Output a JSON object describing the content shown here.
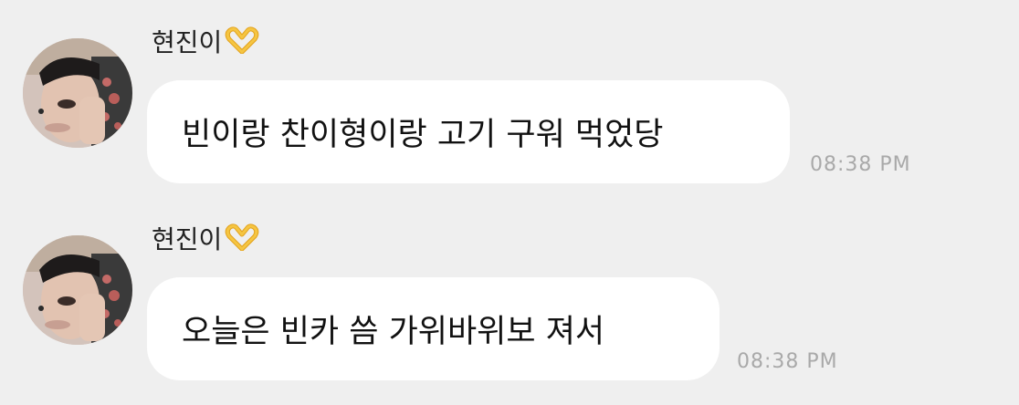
{
  "messages": [
    {
      "sender": "현진이",
      "sender_emoji": "heart-hands-icon",
      "text": "빈이랑 찬이형이랑 고기 구워 먹었당",
      "time": "08:38 PM"
    },
    {
      "sender": "현진이",
      "sender_emoji": "heart-hands-icon",
      "text": "오늘은 빈카 씀 가위바위보 져서",
      "time": "08:38 PM"
    }
  ],
  "colors": {
    "background": "#efefef",
    "bubble": "#ffffff",
    "timestamp": "#a9a9a9",
    "emoji": "#f2b82e"
  }
}
